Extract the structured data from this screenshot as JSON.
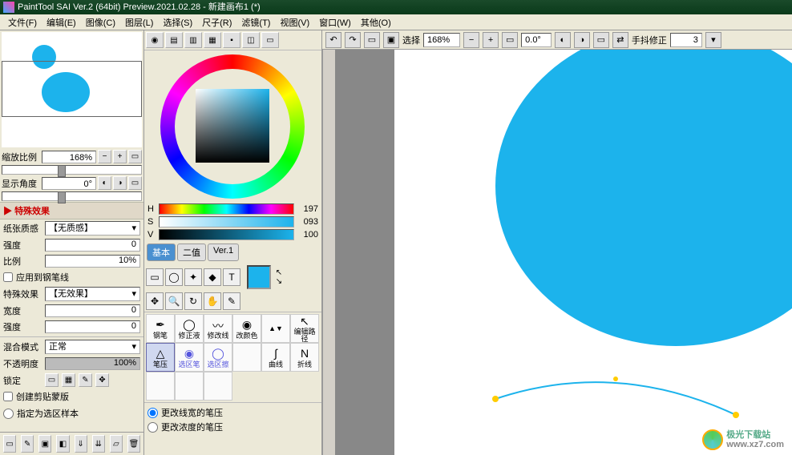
{
  "title": "PaintTool SAI Ver.2 (64bit) Preview.2021.02.28 - 新建画布1 (*)",
  "menu": {
    "file": "文件(F)",
    "edit": "编辑(E)",
    "image": "图像(C)",
    "layer": "图层(L)",
    "select": "选择(S)",
    "ruler": "尺子(R)",
    "filter": "滤镜(T)",
    "view": "视图(V)",
    "window": "窗口(W)",
    "other": "其他(O)"
  },
  "nav": {
    "zoom_label": "缩放比例",
    "zoom_value": "168%",
    "angle_label": "显示角度",
    "angle_value": "0°"
  },
  "special": {
    "head": "特殊效果",
    "paper_label": "纸张质感",
    "paper_value": "【无质感】",
    "strength_label": "强度",
    "strength_value": "0",
    "ratio_label": "比例",
    "ratio_value": "10%",
    "apply_pen": "应用到钢笔线",
    "effect_label": "特殊效果",
    "effect_value": "【无效果】",
    "width_label": "宽度",
    "width_value": "0",
    "str2_label": "强度",
    "str2_value": "0"
  },
  "blend": {
    "mode_label": "混合模式",
    "mode_value": "正常",
    "opacity_label": "不透明度",
    "opacity_value": "100%",
    "lock_label": "锁定",
    "clip_label": "创建剪贴蒙版",
    "sample_label": "指定为选区样本"
  },
  "hsv": {
    "h": "197",
    "s": "093",
    "v": "100"
  },
  "colortabs": {
    "basic": "基本",
    "bin": "二值",
    "ver1": "Ver.1"
  },
  "brushes": {
    "r0": [
      "钢笔",
      "修正液",
      "修改线",
      "改颜色"
    ],
    "r1": [
      "编辑路径",
      "笔压",
      "选区笔",
      "选区擦"
    ],
    "r2": [
      "曲线",
      "折线",
      "",
      ""
    ]
  },
  "pressure": {
    "width": "更改线宽的笔压",
    "density": "更改浓度的笔压"
  },
  "toolbar": {
    "select_label": "选择",
    "zoom": "168%",
    "rotate": "0.0°",
    "stabilizer_label": "手抖修正",
    "stabilizer_value": "3"
  },
  "watermark": {
    "name": "极光下载站",
    "url": "www.xz7.com"
  }
}
